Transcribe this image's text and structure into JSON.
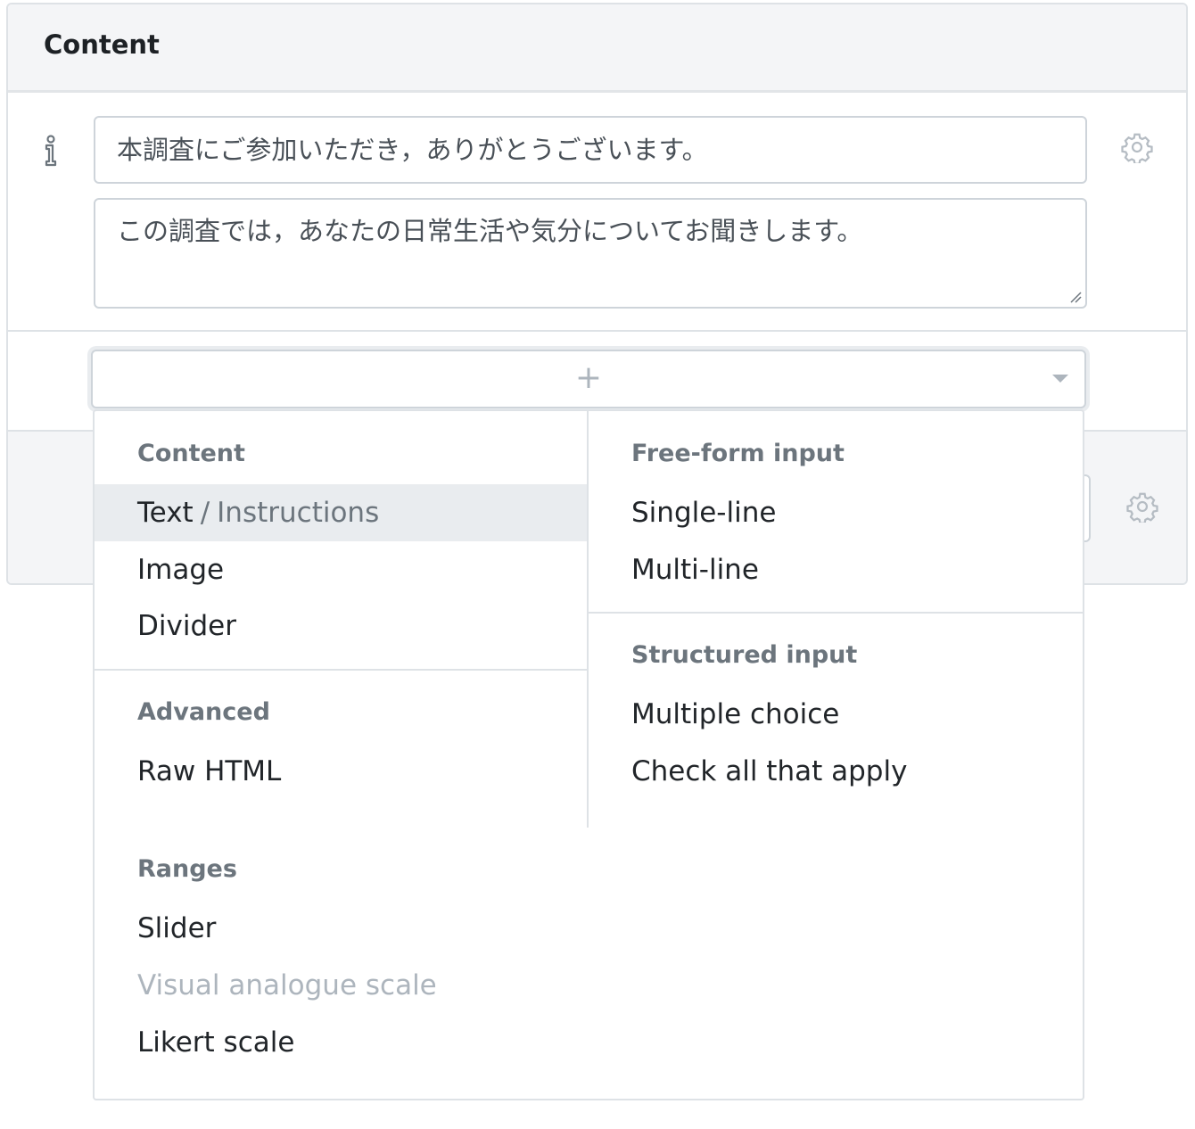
{
  "card": {
    "title": "Content"
  },
  "content_block": {
    "title_value": "本調査にご参加いただき，ありがとうございます。",
    "body_value": "この調査では，あなたの日常生活や気分についてお聞きします。"
  },
  "add_menu": {
    "trigger_label": "+",
    "groups": {
      "content": {
        "header": "Content",
        "items": [
          {
            "label": "Text",
            "sublabel": "Instructions",
            "separator": "/",
            "state": "highlighted"
          },
          {
            "label": "Image"
          },
          {
            "label": "Divider"
          }
        ]
      },
      "advanced": {
        "header": "Advanced",
        "items": [
          {
            "label": "Raw HTML"
          }
        ]
      },
      "freeform": {
        "header": "Free-form input",
        "items": [
          {
            "label": "Single-line"
          },
          {
            "label": "Multi-line"
          }
        ]
      },
      "structured": {
        "header": "Structured input",
        "items": [
          {
            "label": "Multiple choice"
          },
          {
            "label": "Check all that apply"
          }
        ]
      },
      "ranges": {
        "header": "Ranges",
        "items": [
          {
            "label": "Slider"
          },
          {
            "label": "Visual analogue scale",
            "state": "disabled"
          },
          {
            "label": "Likert scale"
          }
        ]
      }
    }
  },
  "icons": [
    "info-icon",
    "gear-icon",
    "plus-icon",
    "chevron-down-icon",
    "resize-handle-icon"
  ],
  "colors": {
    "header_bg": "#f4f5f7",
    "border": "#dee2e6",
    "active_item_bg": "#e9ecef",
    "muted_text": "#6c757d",
    "disabled_text": "#adb5bd"
  }
}
